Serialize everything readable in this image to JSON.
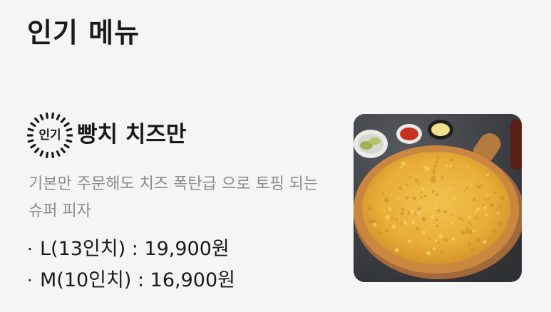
{
  "section": {
    "title": "인기 메뉴"
  },
  "menu_item": {
    "badge_label": "인기",
    "name": "빵치 치즈만",
    "description": "기본만 주문해도 치즈 폭탄급 으로 토핑 되는 슈퍼 피자",
    "prices": [
      {
        "bullet": "·",
        "text": "L(13인치) : 19,900원"
      },
      {
        "bullet": "·",
        "text": "M(10인치) : 16,900원"
      }
    ],
    "image_icon": "cheese-pizza-photo"
  },
  "colors": {
    "background": "#f5f5f6",
    "title_text": "#1a1a1a",
    "description_text": "#8c8c8c",
    "image_backdrop": "#3a3c40",
    "pizza_cheese": "#e8b43a",
    "pizza_crust": "#c9873f"
  }
}
